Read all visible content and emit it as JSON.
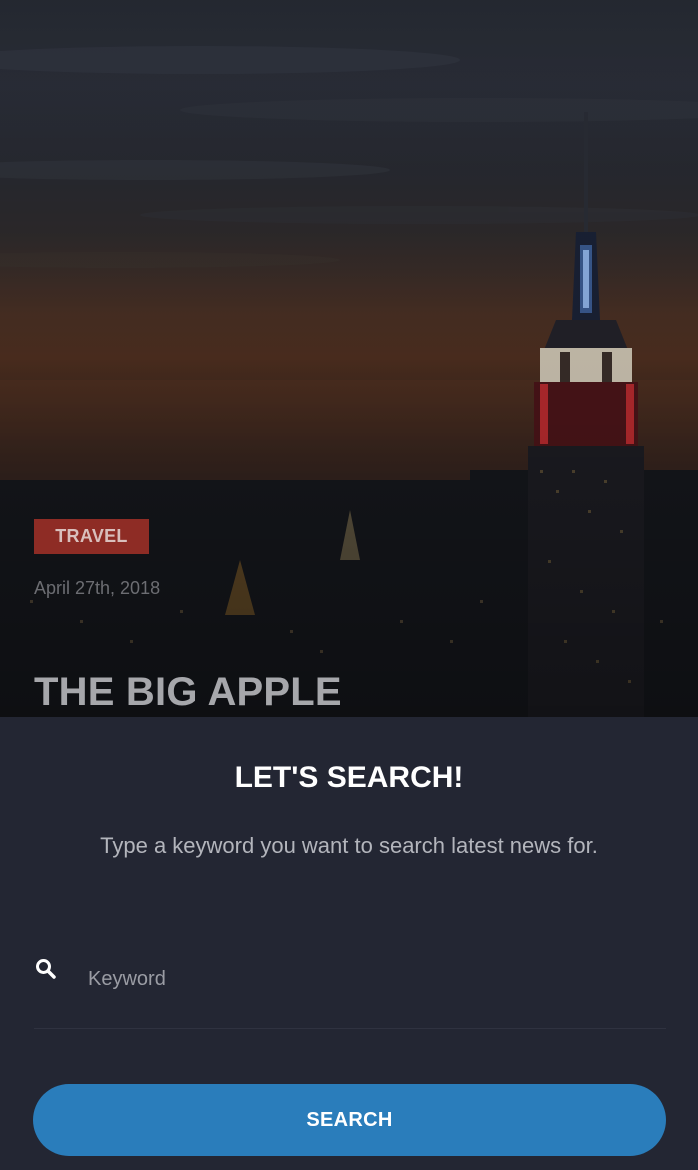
{
  "hero": {
    "category": "TRAVEL",
    "date": "April 27th, 2018",
    "title": "THE BIG APPLE",
    "colors": {
      "category_bg": "#8e2c25"
    }
  },
  "search": {
    "heading": "LET'S SEARCH!",
    "subtitle": "Type a keyword you want to search latest news for.",
    "placeholder": "Keyword",
    "icon": "search-icon",
    "button_label": "SEARCH",
    "colors": {
      "panel_bg": "#232633",
      "button_bg": "#2a7dbb"
    }
  }
}
